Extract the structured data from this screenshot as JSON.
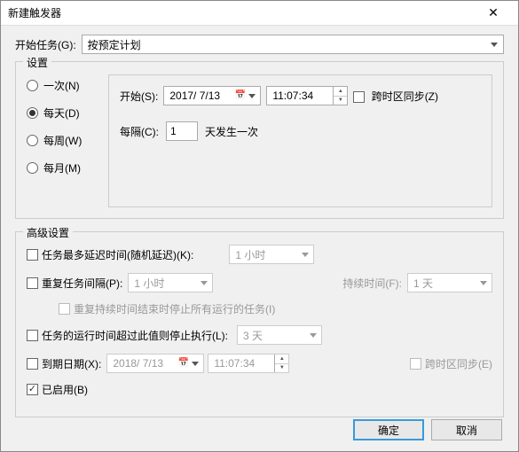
{
  "titlebar": {
    "title": "新建触发器"
  },
  "beginTask": {
    "label": "开始任务(G):",
    "selected": "按预定计划"
  },
  "settings": {
    "legend": "设置",
    "radios": [
      "一次(N)",
      "每天(D)",
      "每周(W)",
      "每月(M)"
    ],
    "selectedRadio": 1,
    "startLabel": "开始(S):",
    "startDate": "2017/ 7/13",
    "startTime": "11:07:34",
    "syncTz": "跨时区同步(Z)",
    "intervalLabel": "每隔(C):",
    "intervalValue": "1",
    "intervalSuffix": "天发生一次"
  },
  "advanced": {
    "legend": "高级设置",
    "delayLabel": "任务最多延迟时间(随机延迟)(K):",
    "delayValue": "1 小时",
    "repeatLabel": "重复任务间隔(P):",
    "repeatInterval": "1 小时",
    "durationLabel": "持续时间(F):",
    "durationValue": "1 天",
    "stopAtEnd": "重复持续时间结束时停止所有运行的任务(I)",
    "stopIfLonger": "任务的运行时间超过此值则停止执行(L):",
    "stopValue": "3 天",
    "expireLabel": "到期日期(X):",
    "expireDate": "2018/ 7/13",
    "expireTime": "11:07:34",
    "syncTz": "跨时区同步(E)",
    "enabledLabel": "已启用(B)"
  },
  "buttons": {
    "ok": "确定",
    "cancel": "取消"
  }
}
